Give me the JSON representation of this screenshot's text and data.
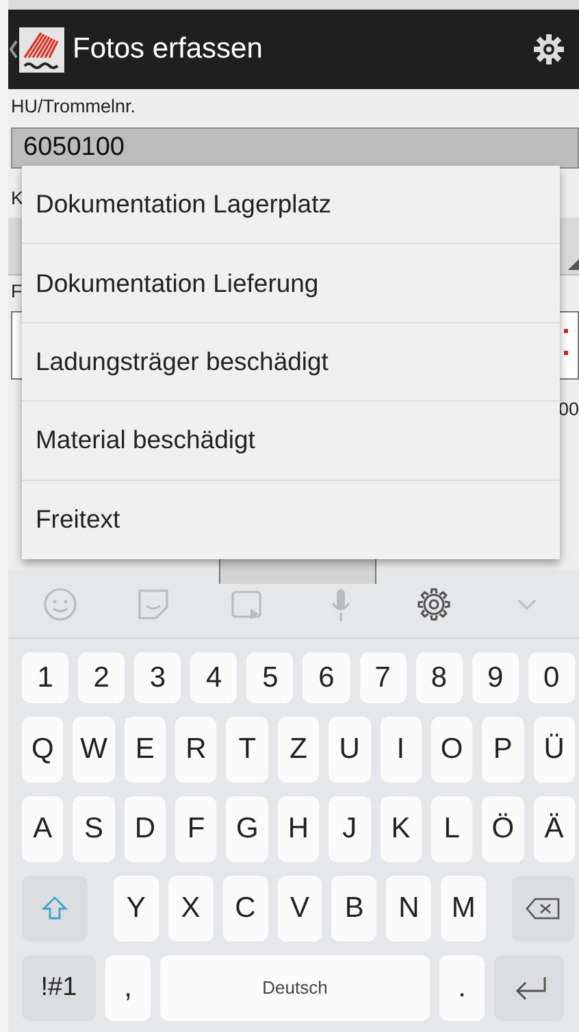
{
  "app_bar": {
    "title": "Fotos erfassen"
  },
  "form": {
    "field_label": "HU/Trommelnr.",
    "field_value": "6050100",
    "label_2": "K",
    "label_3": "F",
    "text_4": "00"
  },
  "dropdown": {
    "items": [
      {
        "label": "Dokumentation Lagerplatz"
      },
      {
        "label": "Dokumentation Lieferung"
      },
      {
        "label": "Ladungsträger beschädigt"
      },
      {
        "label": "Material beschädigt"
      },
      {
        "label": "Freitext"
      }
    ]
  },
  "keyboard": {
    "toolbar": [
      {
        "kind": "emoji"
      },
      {
        "kind": "sticker"
      },
      {
        "kind": "gif"
      },
      {
        "kind": "mic"
      },
      {
        "kind": "settings"
      },
      {
        "kind": "collapse"
      }
    ],
    "number_row": {
      "keys": [
        "1",
        "2",
        "3",
        "4",
        "5",
        "6",
        "7",
        "8",
        "9",
        "0"
      ]
    },
    "letter_row_1": {
      "keys": [
        "Q",
        "W",
        "E",
        "R",
        "T",
        "Z",
        "U",
        "I",
        "O",
        "P",
        "Ü"
      ]
    },
    "letter_row_2": {
      "keys": [
        "A",
        "S",
        "D",
        "F",
        "G",
        "H",
        "J",
        "K",
        "L",
        "Ö",
        "Ä"
      ]
    },
    "letter_row_3": {
      "keys": [
        {
          "kind": "shift"
        },
        "Y",
        "X",
        "C",
        "V",
        "B",
        "N",
        "M",
        {
          "kind": "backspace"
        }
      ]
    },
    "bottom_row": {
      "keys": [
        {
          "kind": "symbols",
          "label": "!#1"
        },
        {
          "kind": "char",
          "label": ","
        },
        {
          "kind": "space",
          "label": "Deutsch"
        },
        {
          "kind": "char",
          "label": "."
        },
        {
          "kind": "enter"
        }
      ]
    }
  }
}
